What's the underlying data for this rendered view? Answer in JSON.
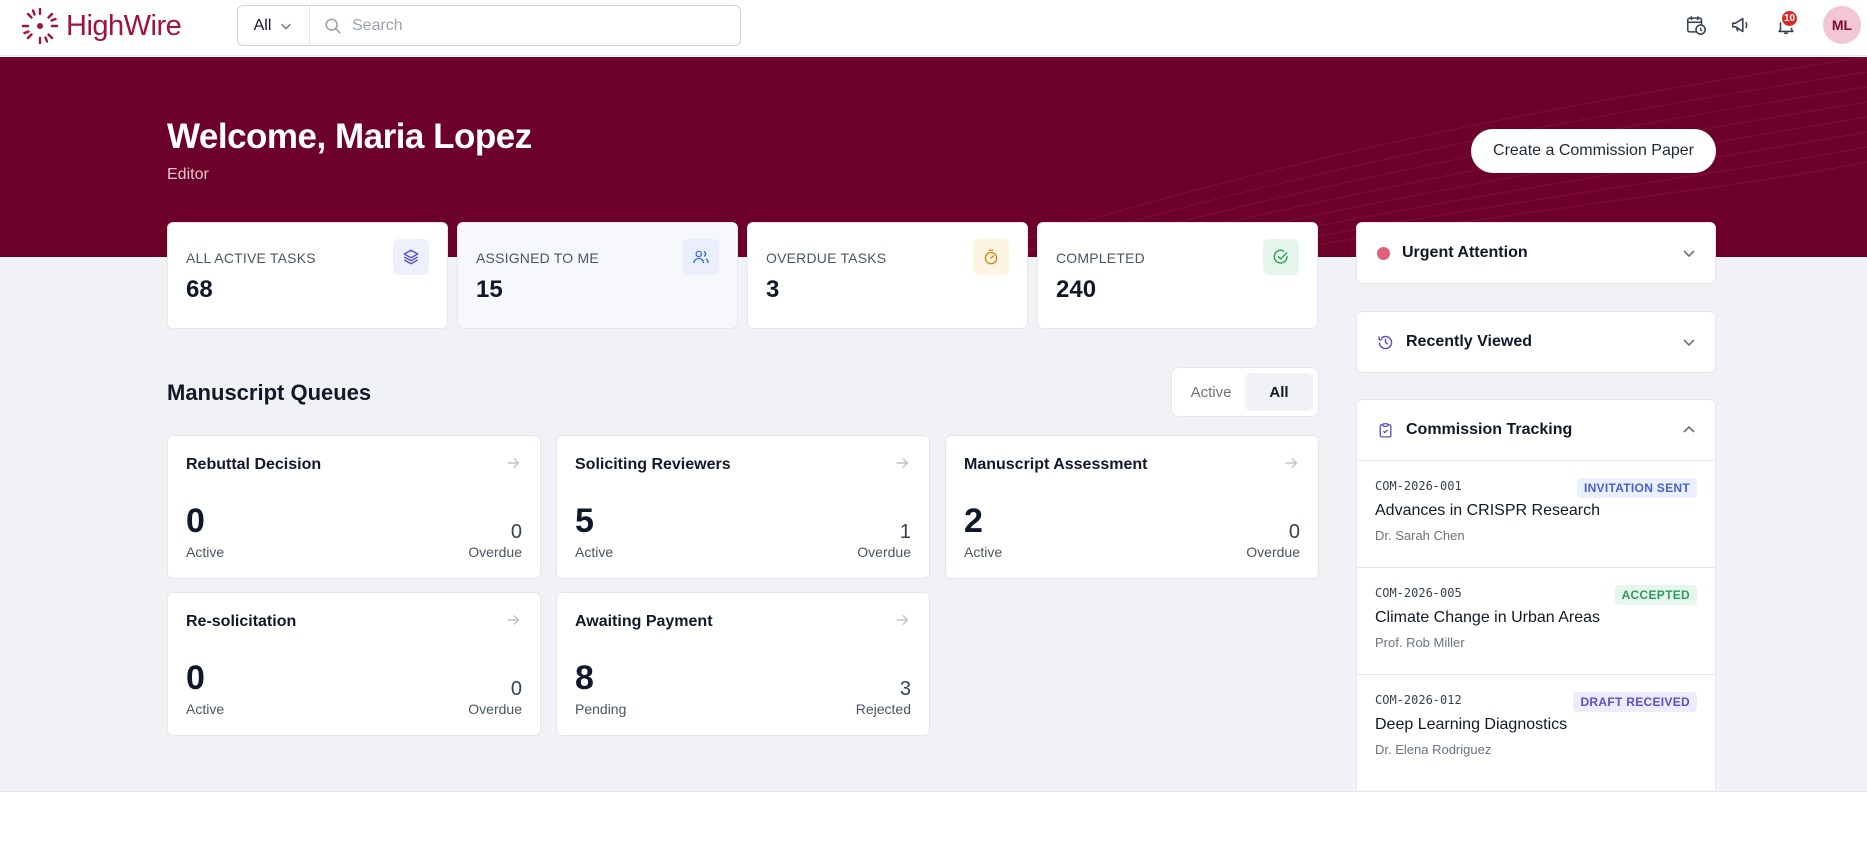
{
  "brand": {
    "name": "HighWire",
    "color": "#a3123f"
  },
  "search": {
    "scope": "All",
    "placeholder": "Search"
  },
  "header": {
    "notification_count": "10",
    "avatar_initials": "ML"
  },
  "hero": {
    "welcome": "Welcome, Maria Lopez",
    "role": "Editor",
    "cta_label": "Create a Commission Paper",
    "background": "#6d0029"
  },
  "stats": [
    {
      "label": "ALL ACTIVE TASKS",
      "value": "68",
      "icon": "layers-icon"
    },
    {
      "label": "ASSIGNED TO ME",
      "value": "15",
      "icon": "users-icon"
    },
    {
      "label": "OVERDUE TASKS",
      "value": "3",
      "icon": "stopwatch-icon"
    },
    {
      "label": "COMPLETED",
      "value": "240",
      "icon": "check-circle-icon"
    }
  ],
  "queues": {
    "title": "Manuscript Queues",
    "filter": {
      "active_label": "Active",
      "all_label": "All",
      "selected": "All"
    },
    "cards": [
      {
        "title": "Rebuttal Decision",
        "primary_value": "0",
        "primary_label": "Active",
        "secondary_value": "0",
        "secondary_label": "Overdue"
      },
      {
        "title": "Soliciting Reviewers",
        "primary_value": "5",
        "primary_label": "Active",
        "secondary_value": "1",
        "secondary_label": "Overdue"
      },
      {
        "title": "Manuscript Assessment",
        "primary_value": "2",
        "primary_label": "Active",
        "secondary_value": "0",
        "secondary_label": "Overdue"
      },
      {
        "title": "Re-solicitation",
        "primary_value": "0",
        "primary_label": "Active",
        "secondary_value": "0",
        "secondary_label": "Overdue"
      },
      {
        "title": "Awaiting Payment",
        "primary_value": "8",
        "primary_label": "Pending",
        "secondary_value": "3",
        "secondary_label": "Rejected"
      }
    ]
  },
  "sidebar": {
    "urgent": {
      "title": "Urgent Attention"
    },
    "recent": {
      "title": "Recently Viewed"
    },
    "commission": {
      "title": "Commission Tracking",
      "items": [
        {
          "code": "COM-2026-001",
          "status": "INVITATION SENT",
          "title": "Advances in CRISPR Research",
          "author": "Dr. Sarah Chen"
        },
        {
          "code": "COM-2026-005",
          "status": "ACCEPTED",
          "title": "Climate Change in Urban Areas",
          "author": "Prof. Rob Miller"
        },
        {
          "code": "COM-2026-012",
          "status": "DRAFT RECEIVED",
          "title": "Deep Learning Diagnostics",
          "author": "Dr. Elena Rodriguez"
        }
      ]
    }
  }
}
